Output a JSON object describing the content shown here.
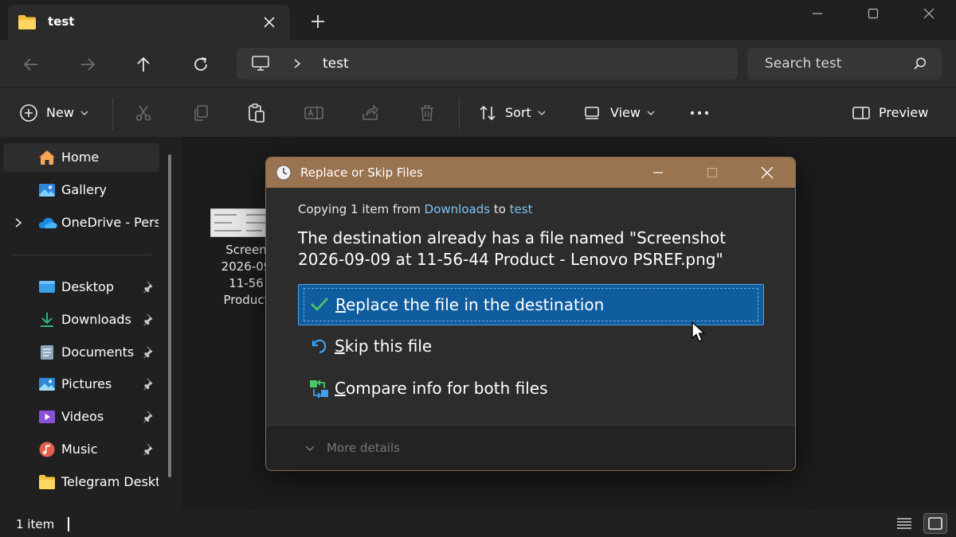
{
  "window": {
    "tab_title": "test",
    "icons": [
      "folder-icon",
      "close-icon",
      "plus-icon",
      "minimize-icon",
      "maximize-icon",
      "close-icon"
    ]
  },
  "address": {
    "breadcrumb": "test",
    "search_placeholder": "Search test"
  },
  "toolbar": {
    "new_label": "New",
    "sort_label": "Sort",
    "view_label": "View",
    "preview_label": "Preview"
  },
  "sidebar": {
    "items": [
      {
        "label": "Home",
        "icon": "home-icon"
      },
      {
        "label": "Gallery",
        "icon": "gallery-icon"
      },
      {
        "label": "OneDrive - Personal",
        "icon": "onedrive-icon"
      },
      {
        "label": "Desktop",
        "icon": "desktop-icon"
      },
      {
        "label": "Downloads",
        "icon": "downloads-icon"
      },
      {
        "label": "Documents",
        "icon": "documents-icon"
      },
      {
        "label": "Pictures",
        "icon": "pictures-icon"
      },
      {
        "label": "Videos",
        "icon": "videos-icon"
      },
      {
        "label": "Music",
        "icon": "music-icon"
      },
      {
        "label": "Telegram Desktop",
        "icon": "folder-icon"
      }
    ]
  },
  "content": {
    "file_name_lines": [
      "Screen",
      "2026-09",
      "11-56",
      "Product"
    ]
  },
  "status": {
    "item_count": "1 item"
  },
  "dialog": {
    "title": "Replace or Skip Files",
    "copy_prefix": "Copying 1 item from ",
    "copy_source": "Downloads",
    "copy_mid": " to ",
    "copy_dest": "test",
    "message": "The destination already has a file named \"Screenshot 2026-09-09 at 11-56-44 Product - Lenovo PSREF.png\"",
    "options": [
      {
        "key": "R",
        "rest": "eplace the file in the destination",
        "icon": "checkmark-icon"
      },
      {
        "key": "S",
        "rest": "kip this file",
        "icon": "skip-icon"
      },
      {
        "key": "C",
        "rest": "ompare info for both files",
        "icon": "compare-icon"
      }
    ],
    "more_details": "More details",
    "accent": "#9a7350",
    "selected_color": "#0f5d9e"
  }
}
